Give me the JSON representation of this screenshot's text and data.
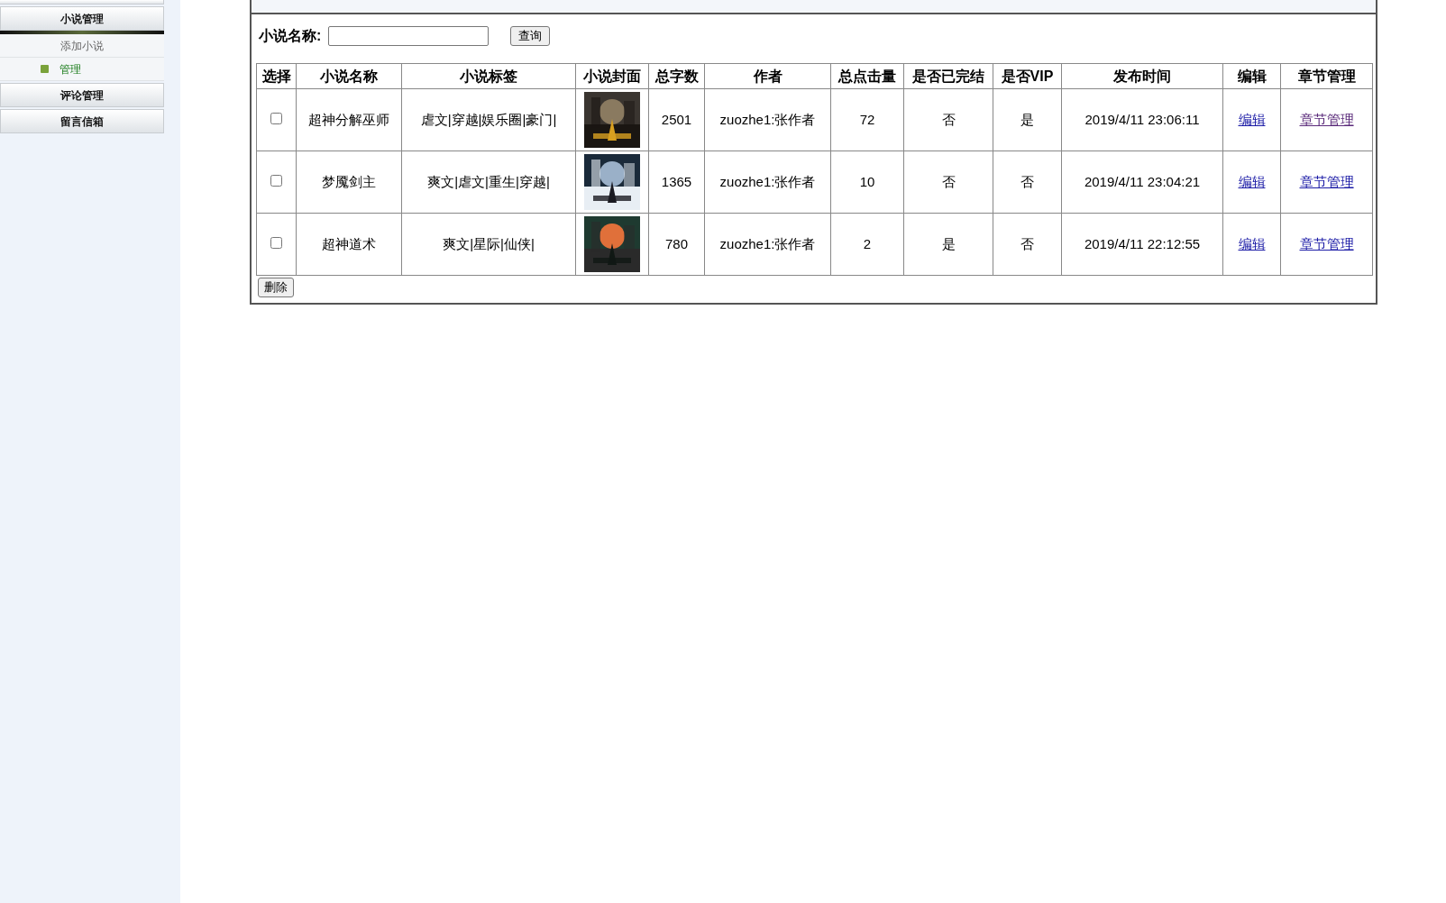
{
  "sidebar": {
    "groups": [
      {
        "label": "小说管理",
        "children": [
          {
            "label": "添加小说",
            "selected": false
          },
          {
            "label": "管理",
            "selected": true
          }
        ]
      },
      {
        "label": "评论管理"
      },
      {
        "label": "留言信箱"
      }
    ]
  },
  "search": {
    "label": "小说名称:",
    "button": "查询"
  },
  "table": {
    "columns": [
      "选择",
      "小说名称",
      "小说标签",
      "小说封面",
      "总字数",
      "作者",
      "总点击量",
      "是否已完结",
      "是否VIP",
      "发布时间",
      "编辑",
      "章节管理"
    ],
    "rows": [
      {
        "checked": false,
        "name": "超神分解巫师",
        "tags": "虐文|穿越|娱乐圈|豪门|",
        "words": "2501",
        "author": "zuozhe1:张作者",
        "clicks": "72",
        "finished": "否",
        "vip": "是",
        "time": "2019/4/11 23:06:11",
        "edit": "编辑",
        "chapters": "章节管理",
        "chapters_visited": true
      },
      {
        "checked": false,
        "name": "梦魇剑主",
        "tags": "爽文|虐文|重生|穿越|",
        "words": "1365",
        "author": "zuozhe1:张作者",
        "clicks": "10",
        "finished": "否",
        "vip": "否",
        "time": "2019/4/11 23:04:21",
        "edit": "编辑",
        "chapters": "章节管理",
        "chapters_visited": false
      },
      {
        "checked": false,
        "name": "超神道术",
        "tags": "爽文|星际|仙侠|",
        "words": "780",
        "author": "zuozhe1:张作者",
        "clicks": "2",
        "finished": "是",
        "vip": "否",
        "time": "2019/4/11 22:12:55",
        "edit": "编辑",
        "chapters": "章节管理",
        "chapters_visited": false
      }
    ]
  },
  "delete_button": "删除"
}
